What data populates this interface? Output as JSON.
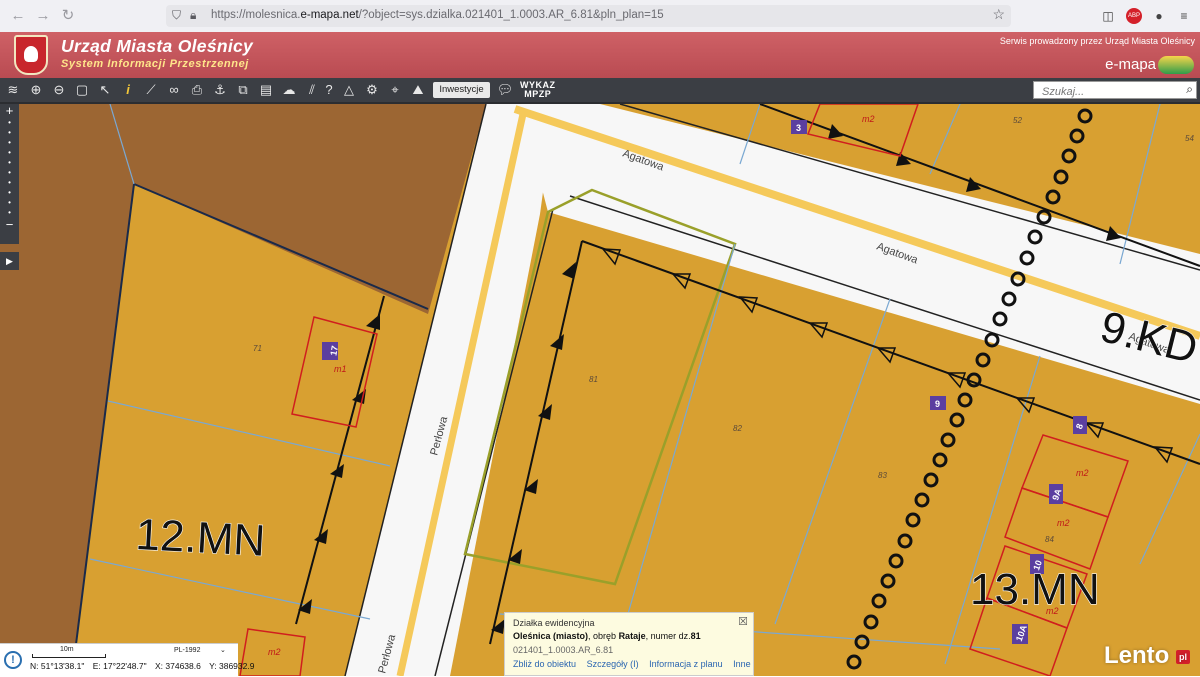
{
  "browser": {
    "url_prefix": "https://molesnica.",
    "url_domain": "e-mapa.net",
    "url_rest": "/?object=sys.dzialka.021401_1.0003.AR_6.81&pln_plan=15"
  },
  "header": {
    "title": "Urząd Miasta Oleśnicy",
    "subtitle": "System Informacji Przestrzennej",
    "service_note": "Serwis prowadzony przez Urząd Miasta Oleśnicy",
    "brand": "e-mapa"
  },
  "toolbar": {
    "investments_label": "Inwestycje",
    "wykaz_line1": "WYKAZ",
    "wykaz_line2": "MPZP",
    "search_placeholder": "Szukaj..."
  },
  "map": {
    "zones": [
      "12.MN",
      "13.MN",
      "9.KD"
    ],
    "streets": [
      "Agatowa",
      "Agatowa",
      "Agatowa",
      "Perłowa",
      "Perłowa"
    ],
    "parcel_numbers": [
      "71",
      "81",
      "82",
      "83",
      "84",
      "52",
      "54"
    ],
    "building_codes": [
      "m1",
      "m2",
      "m2",
      "m2",
      "m2",
      "m2"
    ],
    "house_numbers": [
      "17",
      "3",
      "9",
      "8",
      "9A",
      "10",
      "10A"
    ],
    "colors": {
      "parcel_fill": "#d8a031",
      "forest_fill": "#9c6633",
      "road_fill": "#f7f7f7",
      "street_edge": "#f5c95a",
      "parcel_border": "#7aa8d2",
      "building_outline": "#d01e1e",
      "label_badge": "#5b3fa0"
    }
  },
  "scale": {
    "distance": "10m",
    "crs": "PL-1992",
    "lat": "N: 51°13'38.1\"",
    "lon": "E: 17°22'48.7\"",
    "x": "X: 374638.6",
    "y": "Y: 386932.9"
  },
  "popup": {
    "heading": "Działka ewidencyjna",
    "place": "Oleśnica (miasto)",
    "obreb_prefix": ", obręb ",
    "obreb": "Rataje",
    "number_prefix": ", numer dz.",
    "number": "81",
    "id": "021401_1.0003.AR_6.81",
    "links": [
      "Zbliż do obiektu",
      "Szczegóły (I)",
      "Informacja z planu",
      "Inne"
    ]
  },
  "watermark": "Lento",
  "watermark_badge": "pl"
}
